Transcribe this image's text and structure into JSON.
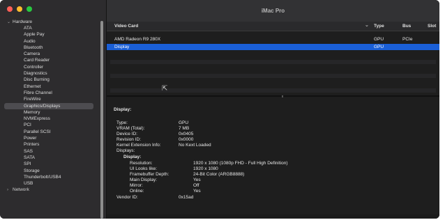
{
  "window": {
    "title": "iMac Pro"
  },
  "sidebar": {
    "section": "Hardware",
    "items": [
      {
        "label": "ATA"
      },
      {
        "label": "Apple Pay"
      },
      {
        "label": "Audio"
      },
      {
        "label": "Bluetooth"
      },
      {
        "label": "Camera"
      },
      {
        "label": "Card Reader"
      },
      {
        "label": "Controller"
      },
      {
        "label": "Diagnostics"
      },
      {
        "label": "Disc Burning"
      },
      {
        "label": "Ethernet"
      },
      {
        "label": "Fibre Channel"
      },
      {
        "label": "FireWire"
      },
      {
        "label": "Graphics/Displays",
        "selected": true
      },
      {
        "label": "Memory"
      },
      {
        "label": "NVMExpress"
      },
      {
        "label": "PCI"
      },
      {
        "label": "Parallel SCSI"
      },
      {
        "label": "Power"
      },
      {
        "label": "Printers"
      },
      {
        "label": "SAS"
      },
      {
        "label": "SATA"
      },
      {
        "label": "SPI"
      },
      {
        "label": "Storage"
      },
      {
        "label": "Thunderbolt/USB4"
      },
      {
        "label": "USB"
      }
    ],
    "next_section": "Network"
  },
  "table": {
    "headers": {
      "name": "Video Card",
      "sort": "⌄",
      "type": "Type",
      "bus": "Bus",
      "slot": "Slot"
    },
    "rows": [
      {
        "name": "AMD Radeon R9 280X",
        "type": "GPU",
        "bus": "PCIe"
      },
      {
        "name": "Display",
        "type": "GPU",
        "bus": ""
      }
    ]
  },
  "details": {
    "title": "Display:",
    "fields": [
      {
        "key": "Type:",
        "value": "GPU"
      },
      {
        "key": "VRAM (Total):",
        "value": "7 MB"
      },
      {
        "key": "Device ID:",
        "value": "0x0405"
      },
      {
        "key": "Revision ID:",
        "value": "0x0000"
      },
      {
        "key": "Kernel Extension Info:",
        "value": "No Kext Loaded"
      },
      {
        "key": "Displays:",
        "value": ""
      }
    ],
    "display_group": "Display:",
    "display_fields": [
      {
        "key": "Resolution:",
        "value": "1920 x 1080 (1080p FHD - Full High Definition)"
      },
      {
        "key": "UI Looks like:",
        "value": "1920 x 1080"
      },
      {
        "key": "Framebuffer Depth:",
        "value": "24-Bit Color (ARGB8888)"
      },
      {
        "key": "Main Display:",
        "value": "Yes"
      },
      {
        "key": "Mirror:",
        "value": "Off"
      },
      {
        "key": "Online:",
        "value": "Yes"
      }
    ],
    "vendor": {
      "key": "Vendor ID:",
      "value": "0x15ad"
    }
  },
  "colors": {
    "selection": "#1a5fd7",
    "sidebar_bg": "#2d2c2e",
    "main_bg": "#1e1e1e"
  }
}
